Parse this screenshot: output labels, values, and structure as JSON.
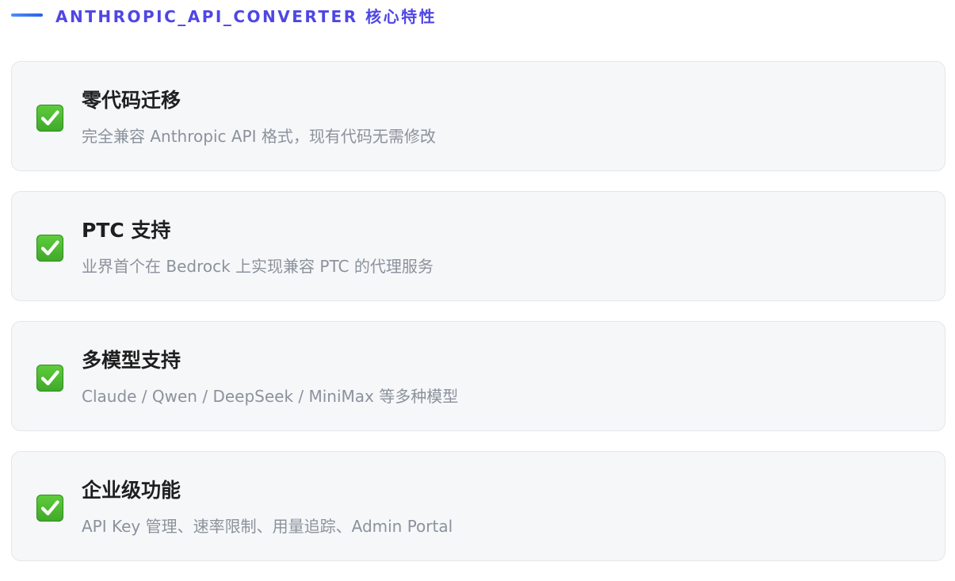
{
  "header": {
    "title": "ANTHROPIC_API_CONVERTER 核心特性",
    "accent_color": "#4f46e5",
    "bar_icon": "gradient-bar-icon"
  },
  "features": [
    {
      "icon": "check-mark-icon",
      "title": "零代码迁移",
      "description": "完全兼容 Anthropic API 格式，现有代码无需修改"
    },
    {
      "icon": "check-mark-icon",
      "title": "PTC 支持",
      "description": "业界首个在 Bedrock 上实现兼容 PTC 的代理服务"
    },
    {
      "icon": "check-mark-icon",
      "title": "多模型支持",
      "description": "Claude / Qwen / DeepSeek / MiniMax 等多种模型"
    },
    {
      "icon": "check-mark-icon",
      "title": "企业级功能",
      "description": "API Key 管理、速率限制、用量追踪、Admin Portal"
    }
  ],
  "colors": {
    "card_background": "#f6f7f9",
    "card_border": "#e4e6ea",
    "check_green": "#4cb832",
    "title_text": "#1f1f1f",
    "description_text": "#8b929c"
  }
}
